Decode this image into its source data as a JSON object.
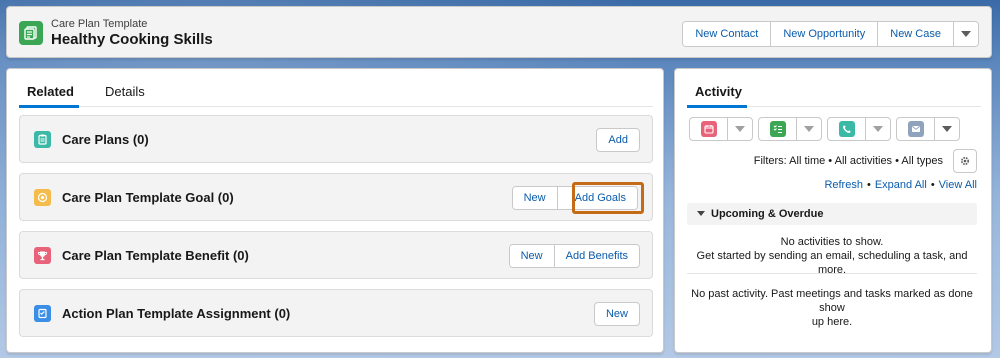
{
  "header": {
    "record_type": "Care Plan Template",
    "record_title": "Healthy Cooking Skills",
    "actions": [
      "New Contact",
      "New Opportunity",
      "New Case"
    ],
    "record_icon": "document-icon",
    "icon_color": "#3ba755"
  },
  "related_panel": {
    "tabs": [
      {
        "label": "Related",
        "active": true
      },
      {
        "label": "Details",
        "active": false
      }
    ],
    "sections": [
      {
        "title": "Care Plans (0)",
        "icon": "clipboard-icon",
        "icon_color": "#3bb9a6",
        "buttons": [
          "Add"
        ]
      },
      {
        "title": "Care Plan Template Goal (0)",
        "icon": "target-icon",
        "icon_color": "#f4bc4d",
        "buttons": [
          "New",
          "Add Goals"
        ],
        "highlighted_button": "Add Goals"
      },
      {
        "title": "Care Plan Template Benefit (0)",
        "icon": "trophy-icon",
        "icon_color": "#e8627a",
        "buttons": [
          "New",
          "Add Benefits"
        ]
      },
      {
        "title": "Action Plan Template Assignment (0)",
        "icon": "action-plan-icon",
        "icon_color": "#3a8ee6",
        "buttons": [
          "New"
        ]
      }
    ],
    "highlight_color": "#c46b15"
  },
  "activity_panel": {
    "tab_label": "Activity",
    "publishers": [
      {
        "name": "calendar-icon",
        "color": "#e8627a"
      },
      {
        "name": "task-list-icon",
        "color": "#3ba755"
      },
      {
        "name": "phone-icon",
        "color": "#3bb9a6"
      },
      {
        "name": "email-icon",
        "color": "#8fa3bd"
      }
    ],
    "filters_text": "Filters: All time • All activities • All types",
    "links": [
      "Refresh",
      "Expand All",
      "View All"
    ],
    "link_separator": "•",
    "upcoming_label": "Upcoming & Overdue",
    "upcoming_empty_line1": "No activities to show.",
    "upcoming_empty_line2": "Get started by sending an email, scheduling a task, and more.",
    "past_empty_line1": "No past activity. Past meetings and tasks marked as done show",
    "past_empty_line2": "up here."
  }
}
